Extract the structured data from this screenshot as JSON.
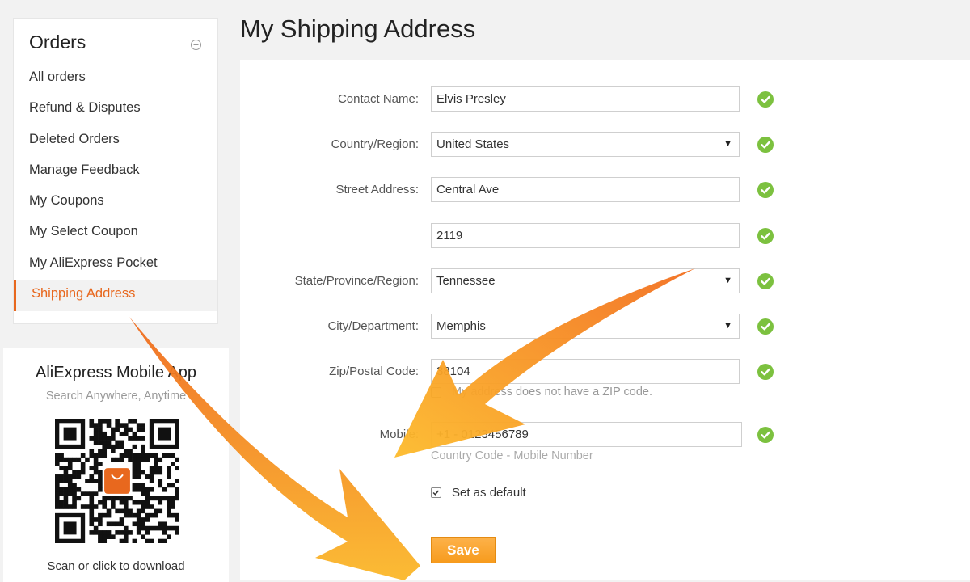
{
  "sidebar": {
    "title": "Orders",
    "items": [
      {
        "label": "All orders"
      },
      {
        "label": "Refund & Disputes"
      },
      {
        "label": "Deleted Orders"
      },
      {
        "label": "Manage Feedback"
      },
      {
        "label": "My Coupons"
      },
      {
        "label": "My Select Coupon"
      },
      {
        "label": "My AliExpress Pocket"
      },
      {
        "label": "Shipping Address",
        "active": true
      }
    ]
  },
  "app": {
    "title": "AliExpress Mobile App",
    "subtitle": "Search Anywhere, Anytime",
    "footer": "Scan or click to download"
  },
  "page": {
    "title": "My Shipping Address"
  },
  "form": {
    "contact_name": {
      "label": "Contact Name:",
      "value": "Elvis Presley"
    },
    "country": {
      "label": "Country/Region:",
      "value": "United States"
    },
    "street": {
      "label": "Street Address:",
      "value": "Central Ave"
    },
    "street2": {
      "value": "2119"
    },
    "state": {
      "label": "State/Province/Region:",
      "value": "Tennessee"
    },
    "city": {
      "label": "City/Department:",
      "value": "Memphis"
    },
    "zip": {
      "label": "Zip/Postal Code:",
      "value": "38104",
      "no_zip_label": "My address does not have a ZIP code.",
      "no_zip_checked": false
    },
    "mobile": {
      "label": "Mobile:",
      "value": "+1 - 0123456789",
      "hint": "Country Code - Mobile Number"
    },
    "set_default": {
      "label": "Set as default",
      "checked": true
    },
    "save_label": "Save"
  },
  "colors": {
    "accent": "#e8681e",
    "ok_green": "#7cc13f",
    "save_orange": "#f79b1d",
    "arrow_orange": "#f47a1f"
  }
}
